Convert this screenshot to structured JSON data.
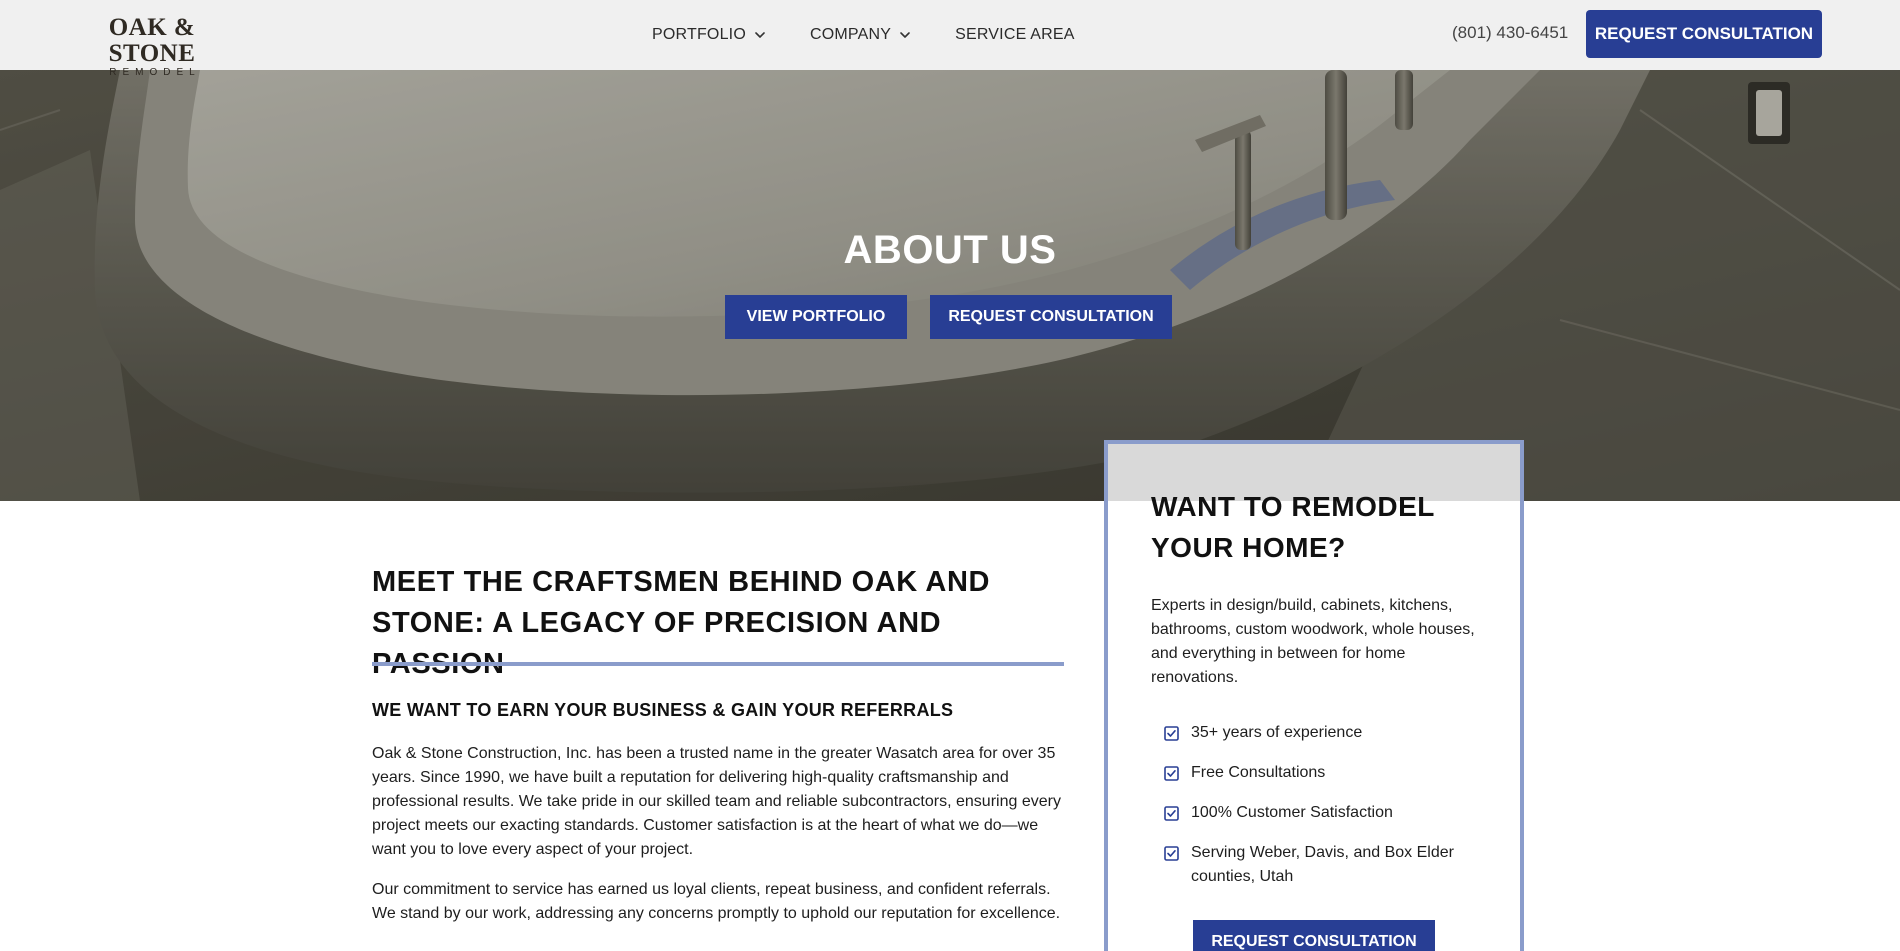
{
  "brand": {
    "name": "OAK & STONE",
    "tagline": "REMODEL"
  },
  "nav": {
    "items": [
      {
        "label": "PORTFOLIO",
        "has_dropdown": true
      },
      {
        "label": "COMPANY",
        "has_dropdown": true
      },
      {
        "label": "SERVICE AREA",
        "has_dropdown": false
      }
    ],
    "phone": "(801) 430-6451",
    "cta_label": "REQUEST CONSULTATION"
  },
  "hero": {
    "title": "ABOUT US",
    "primary_button": "VIEW PORTFOLIO",
    "secondary_button": "REQUEST CONSULTATION"
  },
  "main": {
    "title": "MEET THE CRAFTSMEN BEHIND OAK AND STONE: A LEGACY OF PRECISION AND PASSION",
    "subtitle": "WE WANT TO EARN YOUR BUSINESS & GAIN YOUR REFERRALS",
    "paragraphs": [
      "Oak & Stone Construction, Inc. has been a trusted name in the greater Wasatch area for over 35 years. Since 1990, we have built a reputation for delivering high-quality craftsmanship and professional results. We take pride in our skilled team and reliable subcontractors, ensuring every project meets our exacting standards. Customer satisfaction is at the heart of what we do—we want you to love every aspect of your project.",
      "Our commitment to service has earned us loyal clients, repeat business, and confident referrals. We stand by our work, addressing any concerns promptly to uphold our reputation for excellence."
    ]
  },
  "sidebar_card": {
    "title": "WANT TO REMODEL YOUR HOME?",
    "text": "Experts in design/build, cabinets, kitchens, bathrooms, custom woodwork, whole houses, and everything in between for home renovations.",
    "checklist": [
      "35+ years of experience",
      "Free Consultations",
      "100% Customer Satisfaction",
      "Serving Weber, Davis, and Box Elder counties, Utah"
    ],
    "cta_label": "REQUEST CONSULTATION"
  },
  "colors": {
    "primary": "#283e94",
    "accent_border": "#8a9ccb",
    "header_bg": "#f0f0f0"
  },
  "icons": {
    "nav_dropdown": "chevron-down-icon",
    "checklist": "checkbox-checked-icon"
  }
}
